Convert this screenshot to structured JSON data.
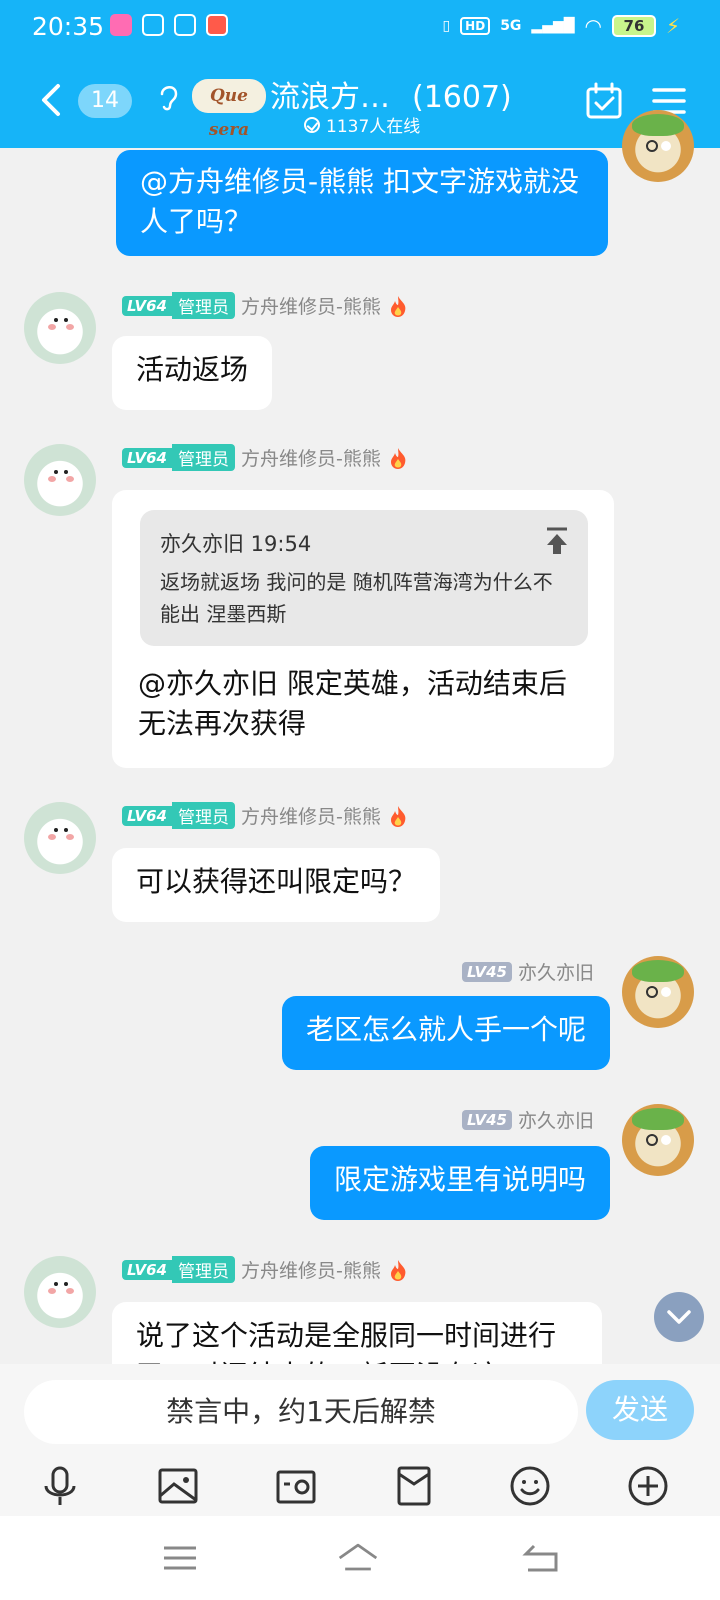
{
  "status_bar": {
    "time": "20:35",
    "network": "5G",
    "hd": "HD",
    "battery": "76"
  },
  "header": {
    "unread_count": "14",
    "logo_text": "Que sera",
    "group_name": "流浪方…",
    "member_count": "(1607)",
    "online_text": "1137人在线"
  },
  "messages": [
    {
      "direction": "out",
      "text": "@方舟维修员-熊熊 扣文字游戏就没人了吗？"
    },
    {
      "direction": "in",
      "level": "LV64",
      "role": "管理员",
      "sender": "方舟维修员-熊熊",
      "text": "活动返场"
    },
    {
      "direction": "in",
      "level": "LV64",
      "role": "管理员",
      "sender": "方舟维修员-熊熊",
      "quote": {
        "author_time": "亦久亦旧 19:54",
        "text": "返场就返场 我问的是 随机阵营海湾为什么不能出 涅墨西斯"
      },
      "text": "@亦久亦旧 限定英雄，活动结束后无法再次获得"
    },
    {
      "direction": "in",
      "level": "LV64",
      "role": "管理员",
      "sender": "方舟维修员-熊熊",
      "text": "可以获得还叫限定吗？"
    },
    {
      "direction": "out",
      "level": "LV45",
      "sender": "亦久亦旧",
      "text": "老区怎么就人手一个呢"
    },
    {
      "direction": "out",
      "level": "LV45",
      "sender": "亦久亦旧",
      "text": "限定游戏里有说明吗"
    },
    {
      "direction": "in",
      "level": "LV64",
      "role": "管理员",
      "sender": "方舟维修员-熊熊",
      "text": "说了这个活动是全服同一时间进行了，时间结束的，新区没有这"
    }
  ],
  "input": {
    "muted_text": "禁言中，约1天后解禁",
    "send_label": "发送"
  },
  "colors": {
    "header_blue": "#16b4f8",
    "bubble_blue": "#0a99ff",
    "admin_badge": "#33c8b6",
    "level_gray": "#a9b2c5"
  },
  "icons": [
    "back-icon",
    "ear-icon",
    "calendar-check-icon",
    "menu-icon",
    "pin-top-icon",
    "chevron-down-icon",
    "microphone-icon",
    "image-icon",
    "camera-icon",
    "red-packet-icon",
    "emoji-icon",
    "plus-icon",
    "nav-menu-icon",
    "nav-home-icon",
    "nav-back-icon"
  ]
}
